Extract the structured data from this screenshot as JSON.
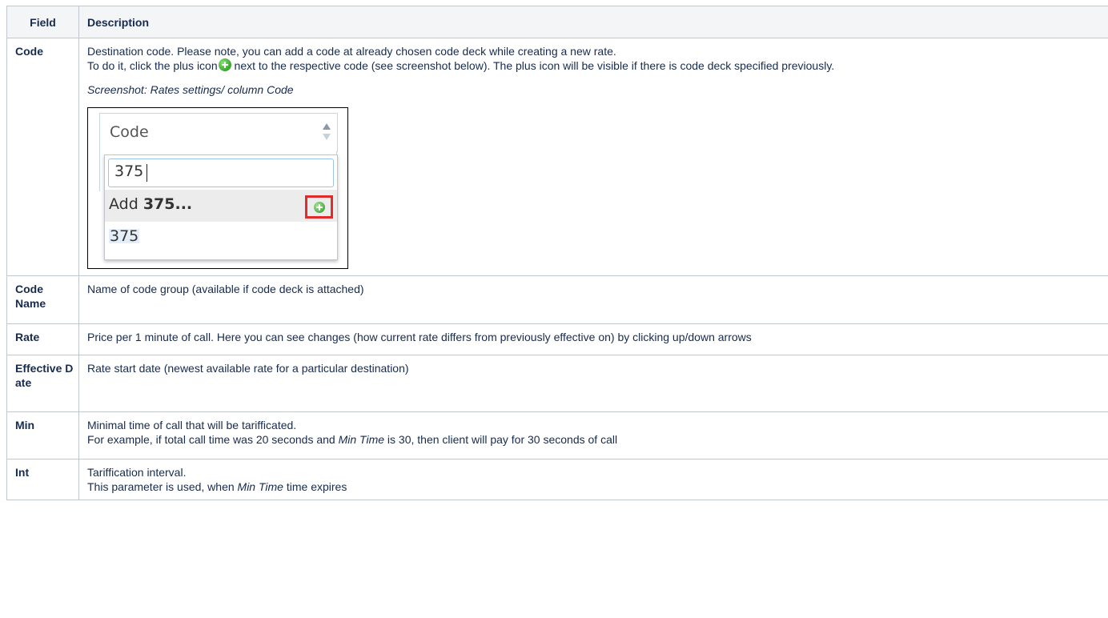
{
  "table": {
    "headers": {
      "field": "Field",
      "description": "Description"
    },
    "rows": [
      {
        "field": "Code",
        "desc_line1": "Destination code. Please note, you can add a code at already chosen code deck while creating a new rate.",
        "desc_line2_before_icon": "To do it, click the plus icon",
        "desc_line2_after_icon": " next to the respective code (see screenshot below). The plus icon will be visible if there is code deck specified previously.",
        "caption": "Screenshot: Rates settings/ column Code",
        "screenshot": {
          "column_header": "Code",
          "input_value": "375",
          "add_prefix": "Add ",
          "add_value": "375...",
          "option": "375"
        }
      },
      {
        "field": "Code Name",
        "description": "Name of code group (available if code deck is attached)"
      },
      {
        "field": "Rate",
        "description": "Price per 1 minute of call. Here you can see changes (how current rate differs from previously effective on) by clicking up/down arrows"
      },
      {
        "field": "Effective Date",
        "description": "Rate start date (newest available rate for a particular destination)"
      },
      {
        "field": "Min",
        "desc_line1": "Minimal time of call that will be tarifficated.",
        "desc_line2_a": "For example, if total call time was 20 seconds and ",
        "desc_line2_em": "Min Time",
        "desc_line2_b": " is 30, then client will pay for 30 seconds of call"
      },
      {
        "field": "Int",
        "desc_line1": "Tariffication interval.",
        "desc_line2_a": "This parameter is used, when ",
        "desc_line2_em": "Min Time",
        "desc_line2_b": " time expires"
      }
    ]
  }
}
